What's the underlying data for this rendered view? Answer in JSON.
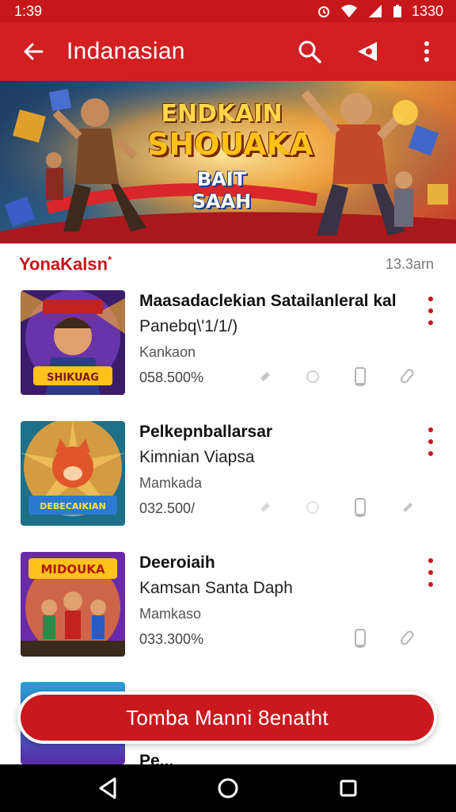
{
  "status_bar": {
    "time": "1:39",
    "right_time": "1330"
  },
  "app_bar": {
    "title": "Indanasian"
  },
  "banner": {
    "line1": "ENDKAIN",
    "line2": "SHOUAKA",
    "line3": "BAIT SAAH"
  },
  "section": {
    "title": "YonaKalsn",
    "marker": "*",
    "time": "13.3arn"
  },
  "items": [
    {
      "name": "Maasadaclekian Satailanleral kal",
      "sub": "Panebq\\'1/1/)",
      "category": "Kankaon",
      "count": "058.500%",
      "thumb_title": "SHIKUAG"
    },
    {
      "name": "Pelkepnballarsar",
      "sub": "Kimnian Viapsa",
      "category": "Mamkada",
      "count": "032.500/",
      "thumb_title": "DEBECAIKIAN"
    },
    {
      "name": "Deeroiaih",
      "sub": "Kamsan Santa Daph",
      "category": "Mamkaso",
      "count": "033.300%",
      "thumb_title": "MIDOUKA"
    }
  ],
  "partial_item": {
    "name": "Pe..."
  },
  "cta": {
    "label": "Tomba Manni 8enatht"
  },
  "colors": {
    "primary": "#d11f22",
    "status": "#c6171b",
    "accent_text": "#c8141b"
  }
}
